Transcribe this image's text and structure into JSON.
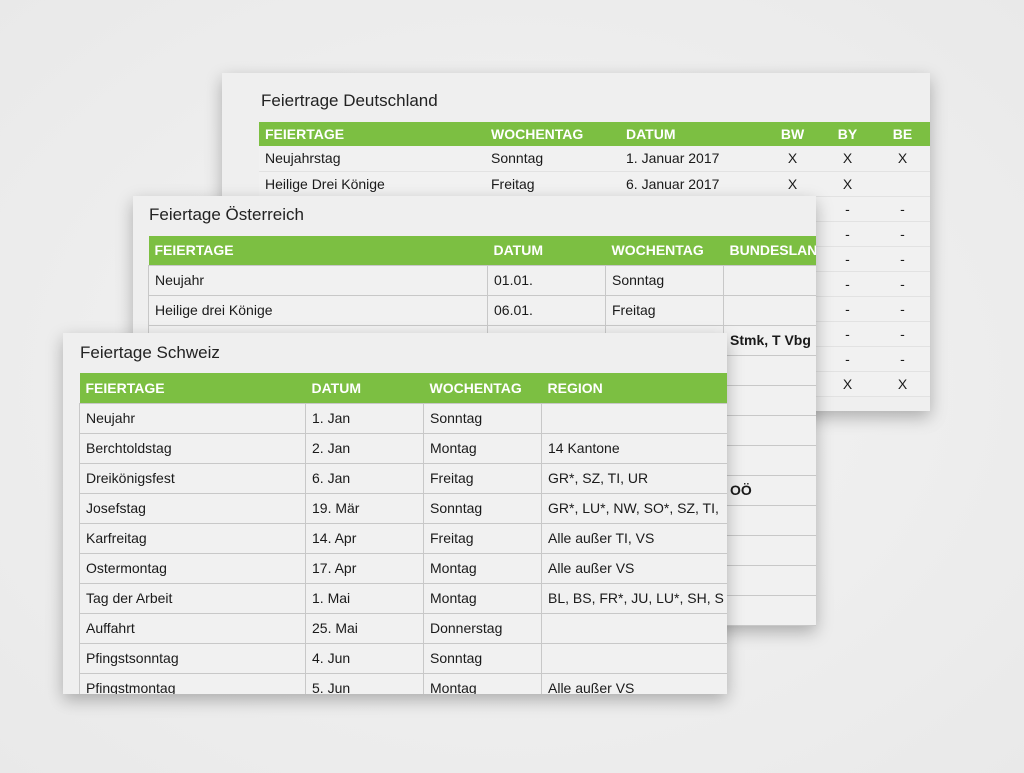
{
  "germany": {
    "title": "Feiertrage Deutschland",
    "headers": [
      "FEIERTAGE",
      "WOCHENTAG",
      "DATUM",
      "BW",
      "BY",
      "BE"
    ],
    "rows": [
      [
        "Neujahrstag",
        "Sonntag",
        "1. Januar 2017",
        "X",
        "X",
        "X"
      ],
      [
        "Heilige Drei Könige",
        "Freitag",
        "6. Januar 2017",
        "X",
        "X",
        ""
      ],
      [
        "",
        "",
        "",
        "",
        "-",
        "-"
      ],
      [
        "",
        "",
        "",
        "",
        "-",
        "-"
      ],
      [
        "",
        "",
        "",
        "",
        "-",
        "-"
      ],
      [
        "",
        "",
        "",
        "",
        "-",
        "-"
      ],
      [
        "",
        "",
        "",
        "",
        "-",
        "-"
      ],
      [
        "",
        "",
        "",
        "",
        "-",
        "-"
      ],
      [
        "",
        "",
        "",
        "",
        "-",
        "-"
      ],
      [
        "",
        "",
        "",
        "",
        "X",
        "X"
      ]
    ]
  },
  "austria": {
    "title": "Feiertage Österreich",
    "headers": [
      "FEIERTAGE",
      "DATUM",
      "WOCHENTAG",
      "BUNDESLAND"
    ],
    "rows": [
      [
        "Neujahr",
        "01.01.",
        "Sonntag",
        ""
      ],
      [
        "Heilige drei Könige",
        "06.01.",
        "Freitag",
        ""
      ],
      [
        "",
        "",
        "",
        "Stmk, T Vbg"
      ],
      [
        "",
        "",
        "",
        ""
      ],
      [
        "",
        "",
        "",
        ""
      ],
      [
        "",
        "",
        "",
        ""
      ],
      [
        "",
        "",
        "",
        ""
      ],
      [
        "",
        "",
        "",
        "OÖ"
      ],
      [
        "",
        "",
        "",
        ""
      ],
      [
        "",
        "",
        "",
        ""
      ],
      [
        "",
        "",
        "",
        ""
      ],
      [
        "",
        "",
        "",
        ""
      ]
    ]
  },
  "switzerland": {
    "title": "Feiertage Schweiz",
    "headers": [
      "FEIERTAGE",
      "DATUM",
      "WOCHENTAG",
      "REGION"
    ],
    "rows": [
      [
        "Neujahr",
        "1. Jan",
        "Sonntag",
        ""
      ],
      [
        "Berchtoldstag",
        "2. Jan",
        "Montag",
        "14 Kantone"
      ],
      [
        "Dreikönigsfest",
        "6. Jan",
        "Freitag",
        "GR*, SZ, TI, UR"
      ],
      [
        "Josefstag",
        "19. Mär",
        "Sonntag",
        "GR*, LU*, NW, SO*, SZ, TI,"
      ],
      [
        "Karfreitag",
        "14. Apr",
        "Freitag",
        "Alle außer TI, VS"
      ],
      [
        "Ostermontag",
        "17. Apr",
        "Montag",
        "Alle außer VS"
      ],
      [
        "Tag der Arbeit",
        "1. Mai",
        "Montag",
        "BL, BS, FR*, JU, LU*, SH, S"
      ],
      [
        "Auffahrt",
        "25. Mai",
        "Donnerstag",
        ""
      ],
      [
        "Pfingstsonntag",
        "4. Jun",
        "Sonntag",
        ""
      ],
      [
        "Pfingstmontag",
        "5. Jun",
        "Montag",
        "Alle außer VS"
      ]
    ]
  },
  "colors": {
    "header_green": "#7cbf42"
  }
}
